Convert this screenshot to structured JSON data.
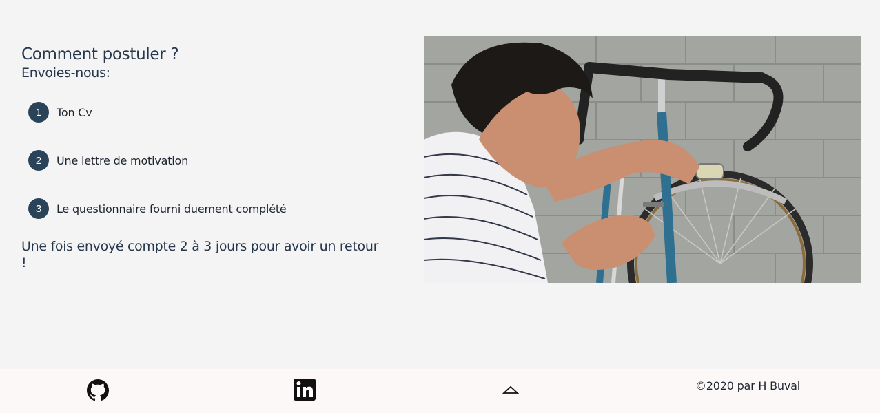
{
  "content": {
    "title": "Comment postuler ?",
    "subtitle": "Envoies-nous:",
    "steps": [
      {
        "number": "1",
        "label": "Ton Cv"
      },
      {
        "number": "2",
        "label": "Une lettre de motivation"
      },
      {
        "number": "3",
        "label": "Le questionnaire fourni duement complété"
      }
    ],
    "note": "Une fois envoyé compte 2 à 3 jours pour avoir un retour !",
    "accent_color": "#2a4359",
    "text_color": "#27384c"
  },
  "footer": {
    "github_icon": "github-icon",
    "linkedin_icon": "linkedin-icon",
    "scroll_top_icon": "chevron-up-icon",
    "copyright": "©2020 par H Buval"
  }
}
